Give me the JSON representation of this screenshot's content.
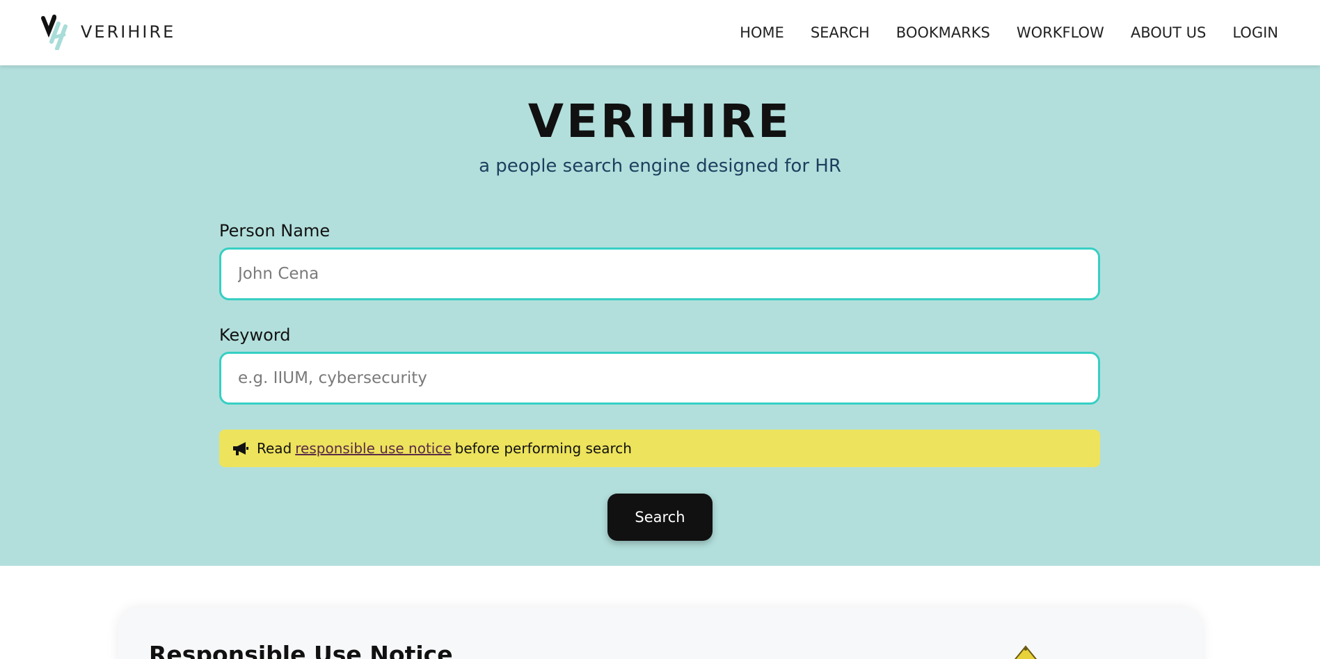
{
  "brand": {
    "name": "VERIHIRE"
  },
  "nav": {
    "items": [
      {
        "label": "HOME"
      },
      {
        "label": "SEARCH"
      },
      {
        "label": "BOOKMARKS"
      },
      {
        "label": "WORKFLOW"
      },
      {
        "label": "ABOUT US"
      },
      {
        "label": "LOGIN"
      }
    ]
  },
  "hero": {
    "title": "VERIHIRE",
    "subtitle": "a people search engine designed for HR"
  },
  "form": {
    "person_name_label": "Person Name",
    "person_name_placeholder": "John Cena",
    "keyword_label": "Keyword",
    "keyword_placeholder": "e.g. IIUM, cybersecurity",
    "notice": {
      "prefix": "Read",
      "link": "responsible use notice",
      "suffix": "before performing search",
      "icon": "megaphone-icon"
    },
    "search_button": "Search"
  },
  "notice_card": {
    "title": "Responsible Use Notice"
  },
  "colors": {
    "hero_bg": "#b2dfdc",
    "input_border": "#36cfc3",
    "notice_bg": "#ede35c",
    "button_bg": "#111111"
  }
}
